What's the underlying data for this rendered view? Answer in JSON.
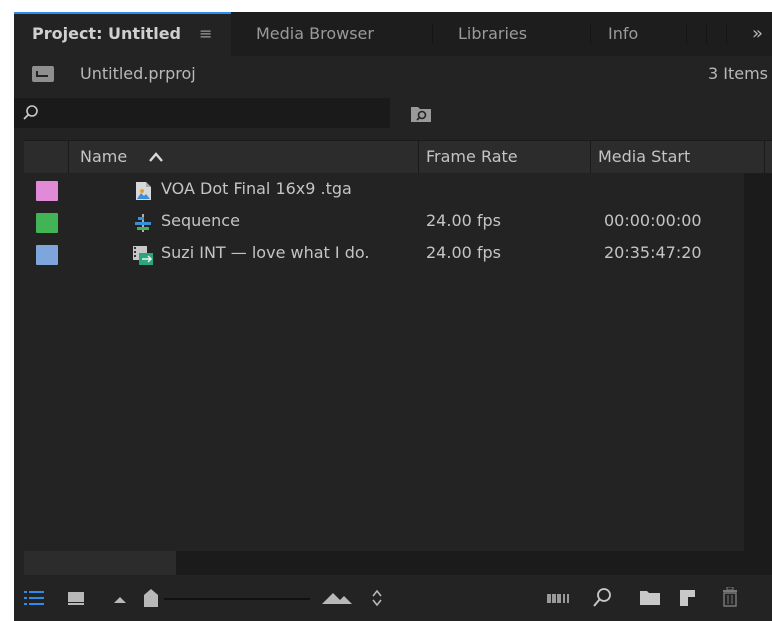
{
  "tabs": [
    {
      "label": "Project: Untitled",
      "active": true
    },
    {
      "label": "Media Browser",
      "active": false
    },
    {
      "label": "Libraries",
      "active": false
    },
    {
      "label": "Info",
      "active": false
    }
  ],
  "tab_menu_glyph": "≡",
  "overflow_glyph": "»",
  "project": {
    "name": "Untitled.prproj",
    "item_count": "3 Items"
  },
  "search": {
    "value": "",
    "placeholder": ""
  },
  "columns": {
    "name": "Name",
    "frame_rate": "Frame Rate",
    "media_start": "Media Start"
  },
  "items": [
    {
      "label_color": "#e08ad8",
      "icon": "still-image-icon",
      "name": "VOA Dot Final 16x9 .tga",
      "frame_rate": "",
      "media_start": ""
    },
    {
      "label_color": "#43b456",
      "icon": "sequence-icon",
      "name": "Sequence",
      "frame_rate": "24.00 fps",
      "media_start": "00:00:00:00"
    },
    {
      "label_color": "#7ea6dc",
      "icon": "video-clip-icon",
      "name": "Suzi INT — love what I do.",
      "frame_rate": "24.00 fps",
      "media_start": "20:35:47:20"
    }
  ],
  "toolbar": {
    "list_view": "active",
    "zoom_level": 0.0
  },
  "colors": {
    "accent": "#2d8ceb",
    "panel_bg": "#232323"
  }
}
